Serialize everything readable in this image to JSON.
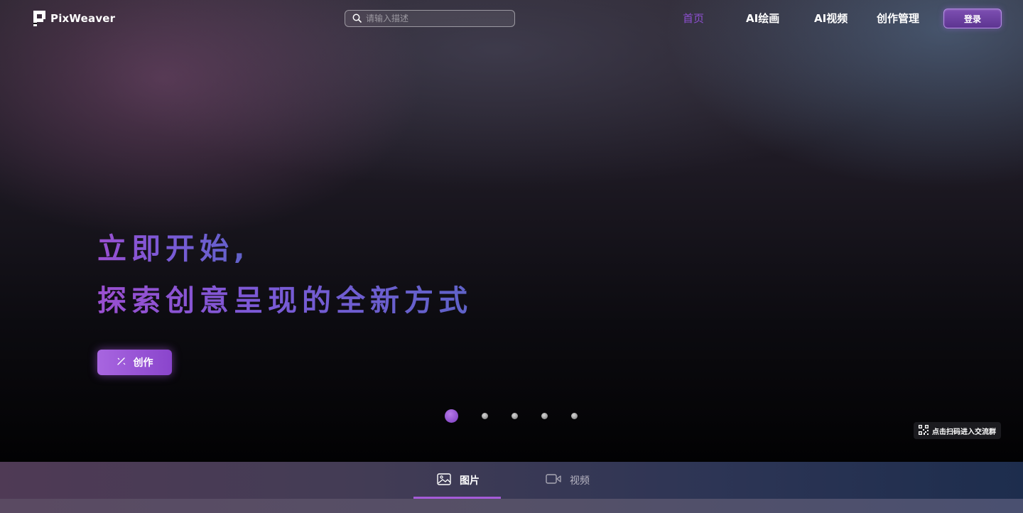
{
  "header": {
    "logo_text": "PixWeaver",
    "search_placeholder": "请输入描述",
    "nav": [
      {
        "label": "首页",
        "active": true
      },
      {
        "label": "AI绘画",
        "active": false
      },
      {
        "label": "AI视频",
        "active": false
      },
      {
        "label": "创作管理",
        "active": false
      }
    ],
    "login_label": "登录"
  },
  "hero": {
    "headline_line1": "立即开始,",
    "headline_line2": "探索创意呈现的全新方式",
    "create_button_label": "创作",
    "carousel": {
      "total": 5,
      "active_index": 0
    }
  },
  "qr_badge_text": "点击扫码进入交流群",
  "tabs": [
    {
      "label": "图片",
      "icon": "image-icon",
      "active": true
    },
    {
      "label": "视频",
      "icon": "video-icon",
      "active": false
    }
  ],
  "colors": {
    "accent": "#8d4fd0",
    "button_gradient_start": "#a866e0",
    "button_gradient_end": "#8a45cc"
  }
}
